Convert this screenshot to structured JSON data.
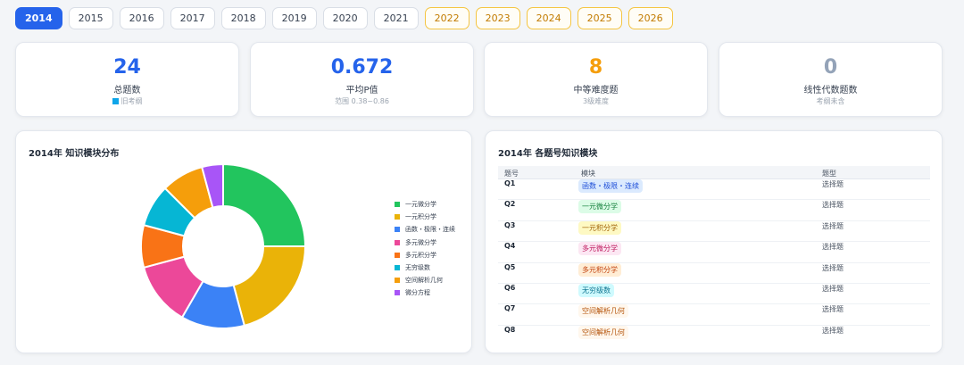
{
  "years": [
    {
      "label": "2014",
      "state": "active"
    },
    {
      "label": "2015",
      "state": "normal"
    },
    {
      "label": "2016",
      "state": "normal"
    },
    {
      "label": "2017",
      "state": "normal"
    },
    {
      "label": "2018",
      "state": "normal"
    },
    {
      "label": "2019",
      "state": "normal"
    },
    {
      "label": "2020",
      "state": "normal"
    },
    {
      "label": "2021",
      "state": "normal"
    },
    {
      "label": "2022",
      "state": "future"
    },
    {
      "label": "2023",
      "state": "future"
    },
    {
      "label": "2024",
      "state": "future"
    },
    {
      "label": "2025",
      "state": "future"
    },
    {
      "label": "2026",
      "state": "future"
    }
  ],
  "stats": [
    {
      "value": "24",
      "label": "总题数",
      "sub": "旧考纲",
      "color": "#2563eb",
      "icon": "square-icon"
    },
    {
      "value": "0.672",
      "label": "平均P值",
      "sub": "范围 0.38~0.86",
      "color": "#2563eb"
    },
    {
      "value": "8",
      "label": "中等难度题",
      "sub": "3级难度",
      "color": "#f59e0b"
    },
    {
      "value": "0",
      "label": "线性代数题数",
      "sub": "考纲未含",
      "color": "#94a3b8"
    }
  ],
  "chart_panel": {
    "title": "2014年 知识模块分布"
  },
  "chart_data": {
    "type": "pie",
    "donut": true,
    "categories": [
      "一元微分学",
      "一元积分学",
      "函数・极限・连续",
      "多元微分学",
      "多元积分学",
      "无穷级数",
      "空间解析几何",
      "微分方程"
    ],
    "values": [
      6,
      5,
      3,
      3,
      2,
      2,
      2,
      1
    ],
    "colors": [
      "#22c55e",
      "#eab308",
      "#3b82f6",
      "#ec4899",
      "#f97316",
      "#06b6d4",
      "#f59e0b",
      "#a855f7"
    ],
    "legend": "right"
  },
  "table_panel": {
    "title": "2014年 各题号知识模块",
    "headers": [
      "题号",
      "模块",
      "题型"
    ],
    "rows": [
      {
        "q": "Q1",
        "module": "函数・极限・连续",
        "type": "选择题",
        "bg": "#dbeafe",
        "fg": "#1d4ed8"
      },
      {
        "q": "Q2",
        "module": "一元微分学",
        "type": "选择题",
        "bg": "#dcfce7",
        "fg": "#15803d"
      },
      {
        "q": "Q3",
        "module": "一元积分学",
        "type": "选择题",
        "bg": "#fef9c3",
        "fg": "#a16207"
      },
      {
        "q": "Q4",
        "module": "多元微分学",
        "type": "选择题",
        "bg": "#fce7f3",
        "fg": "#be185d"
      },
      {
        "q": "Q5",
        "module": "多元积分学",
        "type": "选择题",
        "bg": "#ffedd5",
        "fg": "#c2410c"
      },
      {
        "q": "Q6",
        "module": "无穷级数",
        "type": "选择题",
        "bg": "#cffafe",
        "fg": "#0e7490"
      },
      {
        "q": "Q7",
        "module": "空间解析几何",
        "type": "选择题",
        "bg": "#fff7ed",
        "fg": "#b45309"
      },
      {
        "q": "Q8",
        "module": "空间解析几何",
        "type": "选择题",
        "bg": "#fff7ed",
        "fg": "#b45309"
      }
    ]
  }
}
